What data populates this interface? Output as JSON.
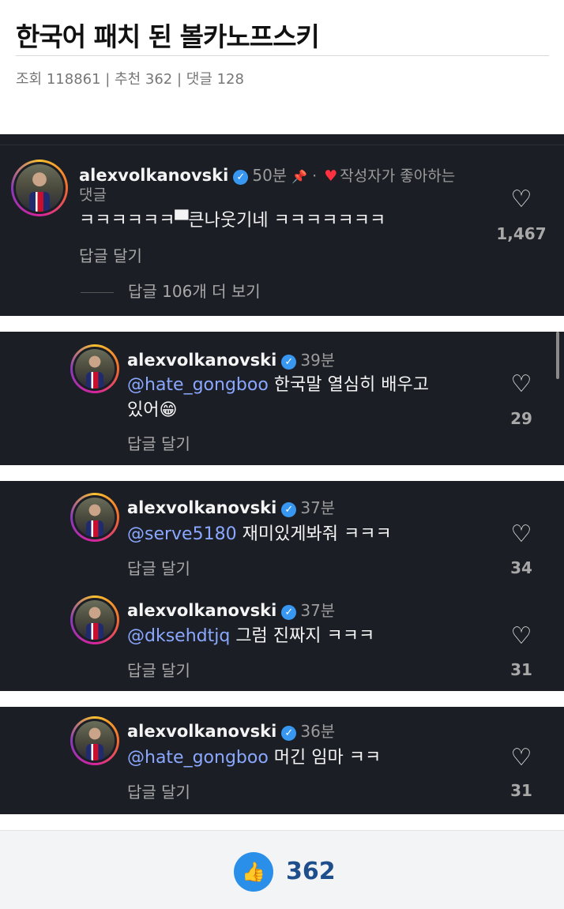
{
  "post": {
    "title": "한국어 패치 된 볼카노프스키",
    "meta": "조회 118861 | 추천 362 | 댓글 128"
  },
  "comments": [
    {
      "username": "alexvolkanovski",
      "time": "50분",
      "liked_by_author": "작성자가 좋아하는",
      "liked_by_author_line2": "댓글",
      "text": "ㅋㅋㅋㅋㅋㅋ▀큰나웃기네 ㅋㅋㅋㅋㅋㅋㅋ",
      "reply_label": "답글 달기",
      "likes": "1,467",
      "view_replies": "답글 106개 더 보기"
    },
    {
      "username": "alexvolkanovski",
      "time": "39분",
      "mention": "@hate_gongboo",
      "text": " 한국말 열심히 배우고",
      "text_line2": "있어😁",
      "reply_label": "답글 달기",
      "likes": "29"
    },
    {
      "username": "alexvolkanovski",
      "time": "37분",
      "mention": "@serve5180",
      "text": " 재미있게봐줘 ㅋㅋㅋ",
      "reply_label": "답글 달기",
      "likes": "34"
    },
    {
      "username": "alexvolkanovski",
      "time": "37분",
      "mention": "@dksehdtjq",
      "text": " 그럼 진짜지 ㅋㅋㅋ",
      "reply_label": "답글 달기",
      "likes": "31"
    },
    {
      "username": "alexvolkanovski",
      "time": "36분",
      "mention": "@hate_gongboo",
      "text": " 머긴 임마 ㅋㅋ",
      "reply_label": "답글 달기",
      "likes": "31"
    }
  ],
  "footer": {
    "recommend_count": "362"
  },
  "icons": {
    "verified": "verified-badge-icon",
    "pin": "pin-icon",
    "heart": "heart-outline-icon",
    "thumb": "thumbs-up-icon"
  },
  "colors": {
    "card_bg": "#1b1e24",
    "mention": "#8aa8ff",
    "verified": "#3897f0",
    "liked_heart": "#ff3040",
    "recommend_button": "#2a8fe8"
  }
}
